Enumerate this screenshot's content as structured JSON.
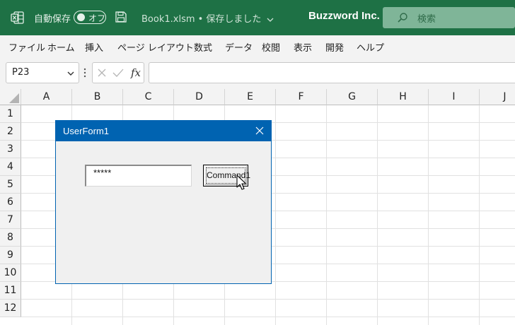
{
  "titlebar": {
    "autosave_label": "自動保存",
    "autosave_toggle": "オフ",
    "document_title": "Book1.xlsm • 保存しました",
    "company": "Buzzword Inc.",
    "search_placeholder": "検索",
    "accent_color": "#1e7145"
  },
  "menu": {
    "items": [
      "ファイル",
      "ホーム",
      "挿入",
      "ページ レイアウト",
      "数式",
      "データ",
      "校閲",
      "表示",
      "開発",
      "ヘルプ"
    ]
  },
  "formula_bar": {
    "name_box": "P23",
    "fx_label": "fx",
    "formula": ""
  },
  "grid": {
    "columns": [
      "A",
      "B",
      "C",
      "D",
      "E",
      "F",
      "G",
      "H",
      "I",
      "J"
    ],
    "rows": [
      "1",
      "2",
      "3",
      "4",
      "5",
      "6",
      "7",
      "8",
      "9",
      "10",
      "11",
      "12"
    ]
  },
  "userform": {
    "title": "UserForm1",
    "textbox_value": "*****",
    "button_label": "Command1",
    "title_color": "#0063b1"
  }
}
